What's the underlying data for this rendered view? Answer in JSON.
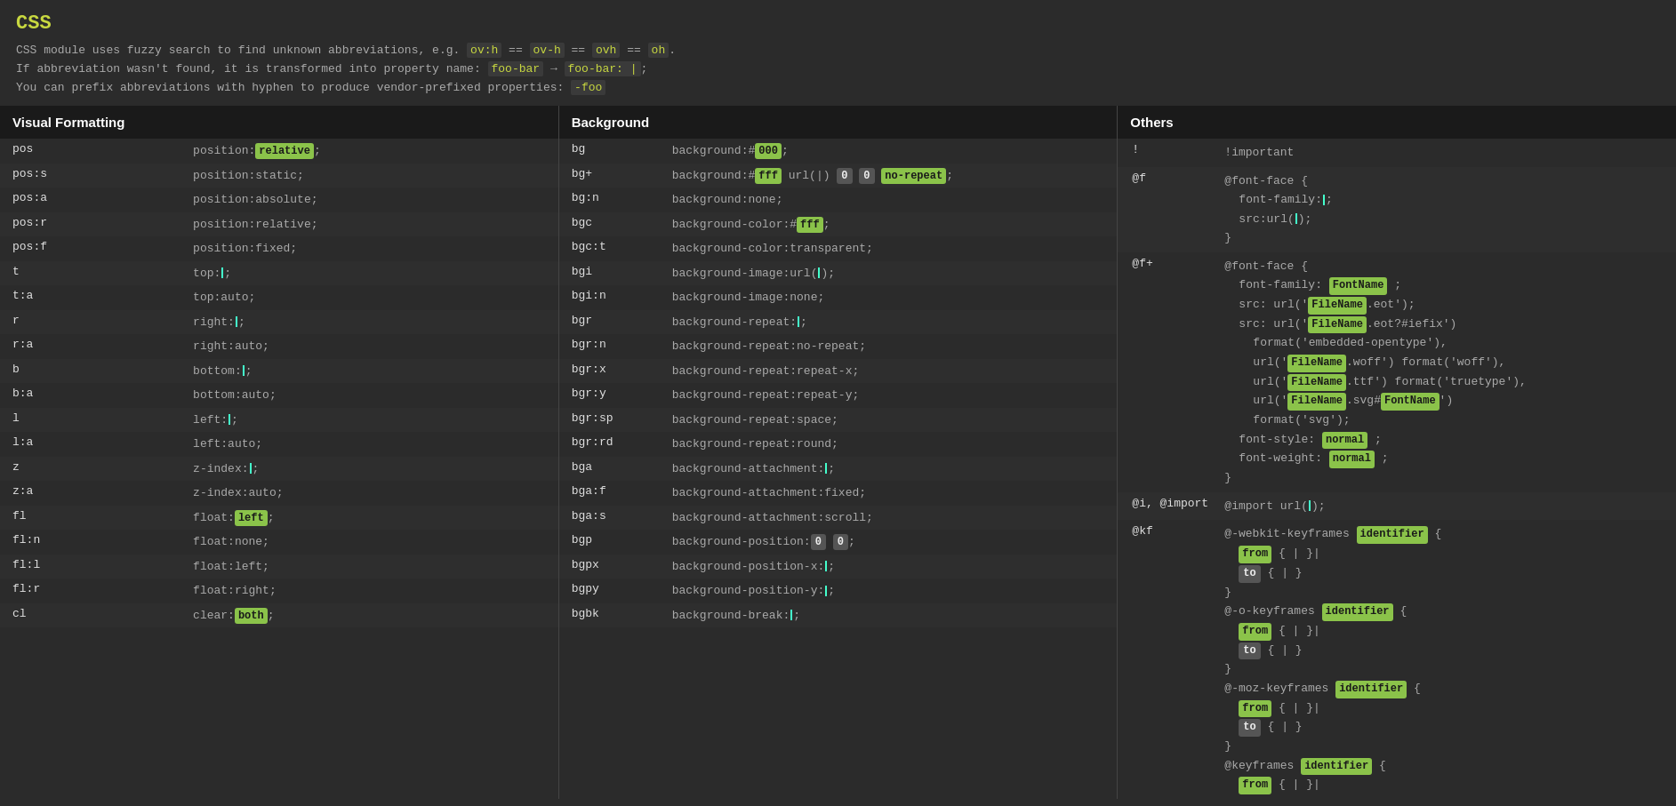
{
  "header": {
    "title": "CSS",
    "desc1_plain": "CSS module uses fuzzy search to find unknown abbreviations, e.g. ",
    "desc1_code1": "ov:h",
    "desc1_mid1": " == ",
    "desc1_code2": "ov-h",
    "desc1_mid2": " == ",
    "desc1_code3": "ovh",
    "desc1_mid3": " == ",
    "desc1_code4": "oh",
    "desc1_end": ".",
    "desc2_plain": "If abbreviation wasn't found, it is transformed into property name: ",
    "desc2_code1": "foo-bar",
    "desc2_mid": " → ",
    "desc2_code2": "foo-bar: |",
    "desc2_end": ";",
    "desc3_plain": "You can prefix abbreviations with hyphen to produce vendor-prefixed properties: ",
    "desc3_code": "-foo"
  },
  "visual_formatting": {
    "title": "Visual Formatting",
    "rows": [
      {
        "key": "pos",
        "val": "position:",
        "badge": "relative",
        "suffix": ";"
      },
      {
        "key": "pos:s",
        "val": "position:static;"
      },
      {
        "key": "pos:a",
        "val": "position:absolute;"
      },
      {
        "key": "pos:r",
        "val": "position:relative;"
      },
      {
        "key": "pos:f",
        "val": "position:fixed;"
      },
      {
        "key": "t",
        "val": "top:",
        "cursor": true,
        "suffix": ";"
      },
      {
        "key": "t:a",
        "val": "top:auto;"
      },
      {
        "key": "r",
        "val": "right:",
        "cursor": true,
        "suffix": ";"
      },
      {
        "key": "r:a",
        "val": "right:auto;"
      },
      {
        "key": "b",
        "val": "bottom:",
        "cursor": true,
        "suffix": ";"
      },
      {
        "key": "b:a",
        "val": "bottom:auto;"
      },
      {
        "key": "l",
        "val": "left:",
        "cursor": true,
        "suffix": ";"
      },
      {
        "key": "l:a",
        "val": "left:auto;"
      },
      {
        "key": "z",
        "val": "z-index:",
        "cursor": true,
        "suffix": ";"
      },
      {
        "key": "z:a",
        "val": "z-index:auto;"
      },
      {
        "key": "fl",
        "val": "float:",
        "badge": "left",
        "suffix": ";"
      },
      {
        "key": "fl:n",
        "val": "float:none;"
      },
      {
        "key": "fl:l",
        "val": "float:left;"
      },
      {
        "key": "fl:r",
        "val": "float:right;"
      },
      {
        "key": "cl",
        "val": "clear:",
        "badge": "both",
        "suffix": ";"
      }
    ]
  },
  "background": {
    "title": "Background",
    "rows": [
      {
        "key": "bg",
        "val": "background:#",
        "badge": "000",
        "suffix": ";"
      },
      {
        "key": "bg+",
        "val": "background:#",
        "badge": "fff",
        "extra": " url(|) ",
        "badge2": "0",
        "badge3": "0",
        "badge4": "no-repeat",
        "suffix": ";"
      },
      {
        "key": "bg:n",
        "val": "background:none;"
      },
      {
        "key": "bgc",
        "val": "background-color:#",
        "badge": "fff",
        "suffix": ";"
      },
      {
        "key": "bgc:t",
        "val": "background-color:transparent;"
      },
      {
        "key": "bgi",
        "val": "background-image:url(",
        "cursor": true,
        "suffix": ");"
      },
      {
        "key": "bgi:n",
        "val": "background-image:none;"
      },
      {
        "key": "bgr",
        "val": "background-repeat:",
        "cursor": true,
        "suffix": ";"
      },
      {
        "key": "bgr:n",
        "val": "background-repeat:no-repeat;"
      },
      {
        "key": "bgr:x",
        "val": "background-repeat:repeat-x;"
      },
      {
        "key": "bgr:y",
        "val": "background-repeat:repeat-y;"
      },
      {
        "key": "bgr:sp",
        "val": "background-repeat:space;"
      },
      {
        "key": "bgr:rd",
        "val": "background-repeat:round;"
      },
      {
        "key": "bga",
        "val": "background-attachment:",
        "cursor": true,
        "suffix": ";"
      },
      {
        "key": "bga:f",
        "val": "background-attachment:fixed;"
      },
      {
        "key": "bga:s",
        "val": "background-attachment:scroll;"
      },
      {
        "key": "bgp",
        "val": "background-position:",
        "badge": "0",
        "badge2": "0",
        "suffix": ";"
      },
      {
        "key": "bgpx",
        "val": "background-position-x:",
        "cursor": true,
        "suffix": ";"
      },
      {
        "key": "bgpy",
        "val": "background-position-y:",
        "cursor": true,
        "suffix": ";"
      },
      {
        "key": "bgbk",
        "val": "background-break:",
        "cursor": true,
        "suffix": ";"
      }
    ]
  },
  "others": {
    "title": "Others",
    "items": [
      {
        "key": "!",
        "val_lines": [
          "!important"
        ]
      },
      {
        "key": "@f",
        "val_lines": [
          "@font-face {",
          "    font-family:|;",
          "    src:url(|);",
          "}"
        ]
      },
      {
        "key": "@f+",
        "val_lines": [
          "@font-face {",
          "    font-family: FontName ;",
          "    src: url(' FileName .eot');",
          "    src: url(' FileName .eot?#iefix')",
          "format('embedded-opentype'),",
          "         url(' FileName .woff') format('woff'),",
          "         url(' FileName .ttf') format('truetype'),",
          "         url(' FileName .svg# FontName ')",
          "format('svg');",
          "    font-style:  normal ;",
          "    font-weight:  normal ;",
          "}"
        ],
        "has_badges": true
      },
      {
        "key": "@i, @import",
        "val_lines": [
          "@import url(|);"
        ],
        "cursor_in_val": true
      },
      {
        "key": "@kf",
        "val_lines": [
          "@-webkit-keyframes  identifier  {",
          "    from  { | }|",
          "    to  { |  }",
          "}",
          "@-o-keyframes  identifier  {",
          "    from  { | }|",
          "    to  { |  }",
          "}",
          "@-moz-keyframes  identifier  {",
          "    from  { | }|",
          "    to  { |  }",
          "}",
          "@keyframes  identifier  {",
          "    from  { | }|"
        ],
        "has_kf_badges": true
      }
    ]
  }
}
